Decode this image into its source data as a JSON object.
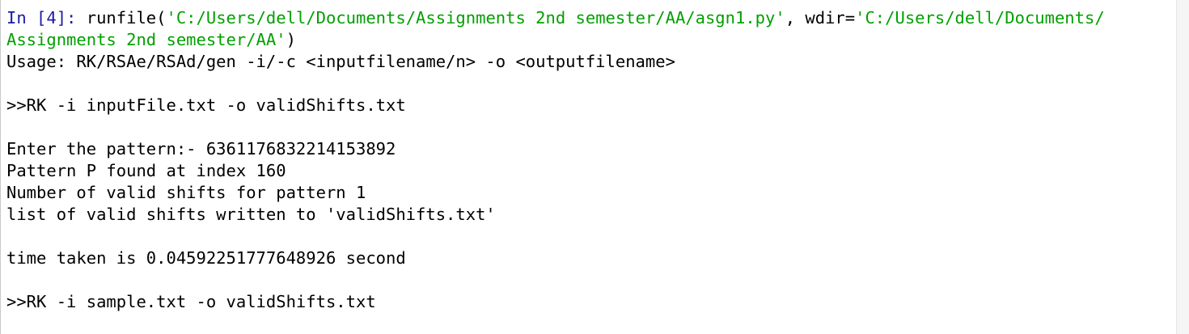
{
  "prompt": {
    "label": "In [4]:",
    "call_open": " runfile(",
    "path": "'C:/Users/dell/Documents/Assignments 2nd semester/AA/asgn1.py'",
    "sep": ", wdir=",
    "wdir_part1": "'C:/Users/dell/Documents/",
    "wdir_part2": "Assignments 2nd semester/AA'",
    "call_close": ")"
  },
  "output": {
    "usage": "Usage: RK/RSAe/RSAd/gen -i/-c <inputfilename/n> -o <outputfilename>",
    "cmd1": ">>RK -i inputFile.txt -o validShifts.txt",
    "enter_pattern": "Enter the pattern:- 6361176832214153892",
    "found": "Pattern P found at index 160",
    "num_shifts": "Number of valid shifts for pattern 1",
    "list_written": "list of valid shifts written to 'validShifts.txt'",
    "time": "time taken is 0.04592251777648926 second",
    "cmd2": ">>RK -i sample.txt -o validShifts.txt"
  },
  "colors": {
    "prompt": "#1a1aa6",
    "string": "#00a000",
    "text": "#000000"
  }
}
